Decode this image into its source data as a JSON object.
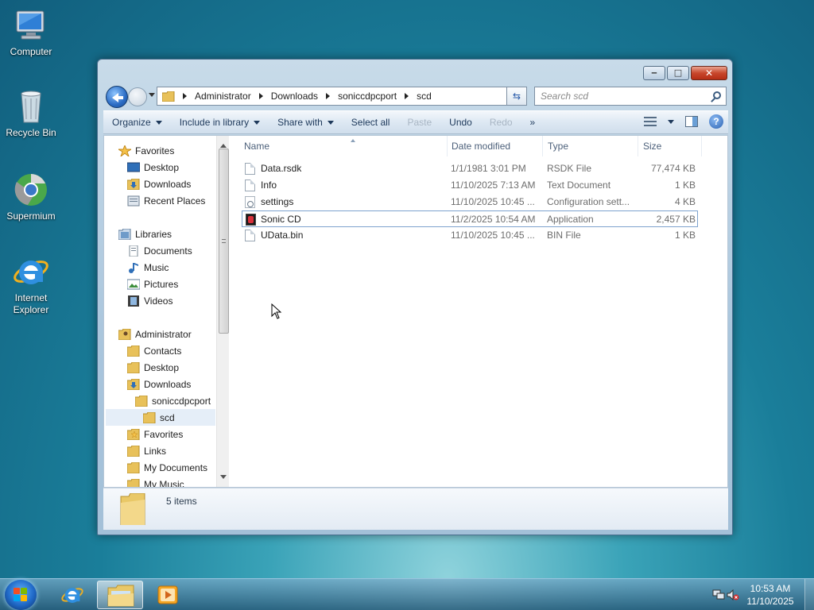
{
  "desktop": {
    "icons": [
      {
        "label": "Computer",
        "icon": "computer-icon"
      },
      {
        "label": "Recycle Bin",
        "icon": "recycle-bin-icon"
      },
      {
        "label": "Supermium",
        "icon": "supermium-icon"
      },
      {
        "label_line1": "Internet",
        "label_line2": "Explorer",
        "icon": "internet-explorer-icon"
      }
    ]
  },
  "window": {
    "address": {
      "breadcrumbs": [
        "Administrator",
        "Downloads",
        "soniccdpcport",
        "scd"
      ]
    },
    "search": {
      "placeholder": "Search scd"
    },
    "toolbar": {
      "organize": "Organize",
      "include_in_library": "Include in library",
      "share_with": "Share with",
      "select_all": "Select all",
      "paste": "Paste",
      "undo": "Undo",
      "redo": "Redo",
      "more": "»"
    },
    "nav_pane": {
      "favorites": {
        "label": "Favorites",
        "items": [
          "Desktop",
          "Downloads",
          "Recent Places"
        ]
      },
      "libraries": {
        "label": "Libraries",
        "items": [
          "Documents",
          "Music",
          "Pictures",
          "Videos"
        ]
      },
      "user": {
        "label": "Administrator",
        "items": [
          "Contacts",
          "Desktop",
          "Downloads",
          "soniccdpcport",
          "scd",
          "Favorites",
          "Links",
          "My Documents",
          "My Music"
        ]
      }
    },
    "columns": {
      "name": "Name",
      "date": "Date modified",
      "type": "Type",
      "size": "Size"
    },
    "files": [
      {
        "name": "Data.rsdk",
        "date": "1/1/1981 3:01 PM",
        "type": "RSDK File",
        "size": "77,474 KB",
        "icon": "file-icon"
      },
      {
        "name": "Info",
        "date": "11/10/2025 7:13 AM",
        "type": "Text Document",
        "size": "1 KB",
        "icon": "text-file-icon"
      },
      {
        "name": "settings",
        "date": "11/10/2025 10:45 ...",
        "type": "Configuration sett...",
        "size": "4 KB",
        "icon": "config-file-icon"
      },
      {
        "name": "Sonic CD",
        "date": "11/2/2025 10:54 AM",
        "type": "Application",
        "size": "2,457 KB",
        "icon": "application-icon"
      },
      {
        "name": "UData.bin",
        "date": "11/10/2025 10:45 ...",
        "type": "BIN File",
        "size": "1 KB",
        "icon": "file-icon"
      }
    ],
    "details": {
      "count": "5 items"
    }
  },
  "taskbar": {
    "clock": {
      "time": "10:53 AM",
      "date": "11/10/2025"
    }
  },
  "colors": {
    "accent": "#1f68c6",
    "selection": "#e5eef8",
    "hover_border": "#7da2ce"
  }
}
